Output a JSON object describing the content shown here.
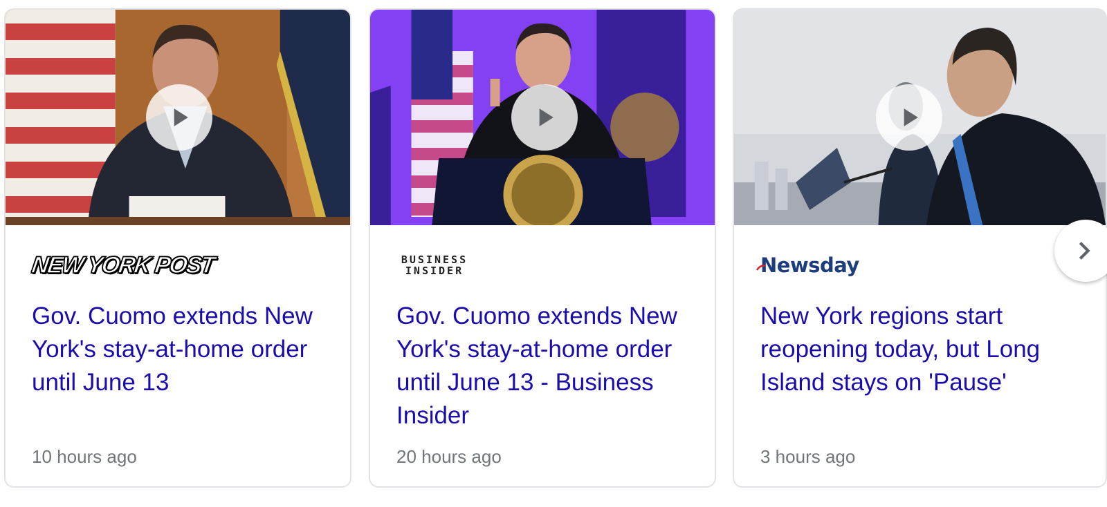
{
  "cards": [
    {
      "source": "NEW YORK POST",
      "headline": "Gov. Cuomo extends New York's stay-at-home order until June 13",
      "time": "10 hours ago",
      "thumbnail_icon": "video-thumbnail"
    },
    {
      "source": "BUSINESS\nINSIDER",
      "headline": "Gov. Cuomo extends New York's stay-at-home order until June 13 - Business Insider",
      "time": "20 hours ago",
      "thumbnail_icon": "video-thumbnail"
    },
    {
      "source": "Newsday",
      "headline": "New York regions start reopening today, but Long Island stays on 'Pause'",
      "time": "3 hours ago",
      "thumbnail_icon": "video-thumbnail"
    }
  ],
  "icons": {
    "play": "play-icon",
    "next": "chevron-right-icon"
  },
  "colors": {
    "headline": "#1a0dab",
    "time": "#70757a",
    "card_border": "#e1e3e6",
    "newsday_blue": "#1e3e7b"
  }
}
